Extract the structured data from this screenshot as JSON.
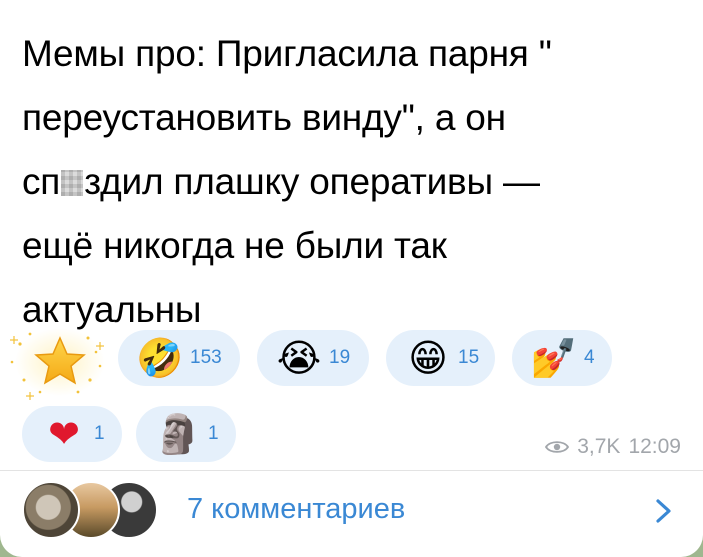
{
  "post": {
    "text_line1": "Мемы про: Пригласила парня \"",
    "text_line2": "переустановить винду\", а он",
    "text_line3_a": "сп",
    "text_line3_b": "здил плашку оперативы —",
    "text_line4": "ещё никогда не были так",
    "text_line5": "актуальны"
  },
  "reactions": {
    "star": {
      "icon": "star-icon"
    },
    "row1": [
      {
        "icon": "rofl-face-icon",
        "emoji": "🤣",
        "count": "153"
      },
      {
        "icon": "crying-face-icon",
        "emoji": "😭",
        "count": "19"
      },
      {
        "icon": "grinning-face-icon",
        "emoji": "😁",
        "count": "15"
      },
      {
        "icon": "nail-polish-icon",
        "emoji": "💅",
        "count": "4"
      }
    ],
    "row2": [
      {
        "icon": "heart-icon",
        "emoji": "❤",
        "count": "1"
      },
      {
        "icon": "moai-icon",
        "emoji": "🗿",
        "count": "1"
      }
    ]
  },
  "meta": {
    "views": "3,7K",
    "time": "12:09",
    "views_icon": "eye-icon"
  },
  "comments": {
    "label": "7 комментариев",
    "chevron_icon": "chevron-right-icon"
  },
  "colors": {
    "accent": "#3a88d4",
    "reaction_bg": "#e5f0fb",
    "meta_text": "#a2a6ab",
    "chat_background": "#9fb78f"
  }
}
